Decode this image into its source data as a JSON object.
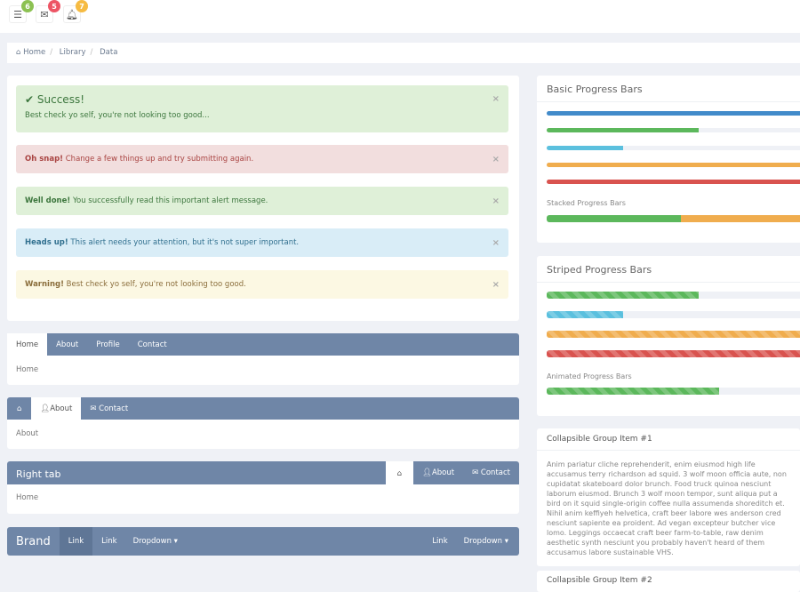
{
  "topbar": {
    "badges": [
      {
        "icon": "tasks-icon",
        "count": "6",
        "color": "#8cc152"
      },
      {
        "icon": "envelope-icon",
        "count": "5",
        "color": "#ed5565"
      },
      {
        "icon": "bell-icon",
        "count": "7",
        "color": "#f6bb42"
      }
    ]
  },
  "breadcrumb": {
    "items": [
      "Home",
      "Library",
      "Data"
    ]
  },
  "alerts": {
    "success": {
      "title": "Success!",
      "text": "Best check yo self, you're not looking too good..."
    },
    "items": [
      {
        "strong": "Oh snap!",
        "text": " Change a few things up and try submitting again.",
        "bg": "#f2dede",
        "color": "#a94442"
      },
      {
        "strong": "Well done!",
        "text": " You successfully read this important alert message.",
        "bg": "#dff0d8",
        "color": "#3c763d"
      },
      {
        "strong": "Heads up!",
        "text": " This alert needs your attention, but it's not super important.",
        "bg": "#d9edf7",
        "color": "#31708f"
      },
      {
        "strong": "Warning!",
        "text": " Best check yo self, you're not looking too good.",
        "bg": "#fcf8e3",
        "color": "#8a6d3b"
      }
    ],
    "close": "×"
  },
  "tabs1": {
    "tabs": [
      "Home",
      "About",
      "Profile",
      "Contact"
    ],
    "content": "Home"
  },
  "tabs2": {
    "tabs": [
      "About",
      "Contact"
    ],
    "content": "About"
  },
  "tabs3": {
    "title": "Right tab",
    "tabs": [
      "About",
      "Contact"
    ],
    "content": "Home"
  },
  "navbar": {
    "brand": "Brand",
    "left": [
      "Link",
      "Link",
      "Dropdown"
    ],
    "right": [
      "Link",
      "Dropdown"
    ]
  },
  "progress": {
    "basic_title": "Basic Progress Bars",
    "basic": [
      {
        "value": 100,
        "color": "#428bca"
      },
      {
        "value": 60,
        "color": "#5cb85c"
      },
      {
        "value": 30,
        "color": "#5bc0de"
      },
      {
        "value": 100,
        "color": "#f0ad4e"
      },
      {
        "value": 100,
        "color": "#d9534f"
      }
    ],
    "stacked_title": "Stacked Progress Bars",
    "stacked": [
      {
        "value": 53,
        "color": "#5cb85c"
      },
      {
        "value": 47,
        "color": "#f0ad4e"
      }
    ],
    "striped_title": "Striped Progress Bars",
    "striped": [
      {
        "value": 60,
        "color": "#5cb85c"
      },
      {
        "value": 30,
        "color": "#5bc0de"
      },
      {
        "value": 100,
        "color": "#f0ad4e"
      },
      {
        "value": 100,
        "color": "#d9534f"
      }
    ],
    "animated_title": "Animated Progress Bars",
    "animated": {
      "value": 68,
      "color": "#5cb85c"
    }
  },
  "accordion": {
    "items": [
      {
        "title": "Collapsible Group Item #1",
        "body": "Anim pariatur cliche reprehenderit, enim eiusmod high life accusamus terry richardson ad squid. 3 wolf moon officia aute, non cupidatat skateboard dolor brunch. Food truck quinoa nesciunt laborum eiusmod. Brunch 3 wolf moon tempor, sunt aliqua put a bird on it squid single-origin coffee nulla assumenda shoreditch et. Nihil anim keffiyeh helvetica, craft beer labore wes anderson cred nesciunt sapiente ea proident. Ad vegan excepteur butcher vice lomo. Leggings occaecat craft beer farm-to-table, raw denim aesthetic synth nesciunt you probably haven't heard of them accusamus labore sustainable VHS."
      },
      {
        "title": "Collapsible Group Item #2"
      }
    ]
  }
}
